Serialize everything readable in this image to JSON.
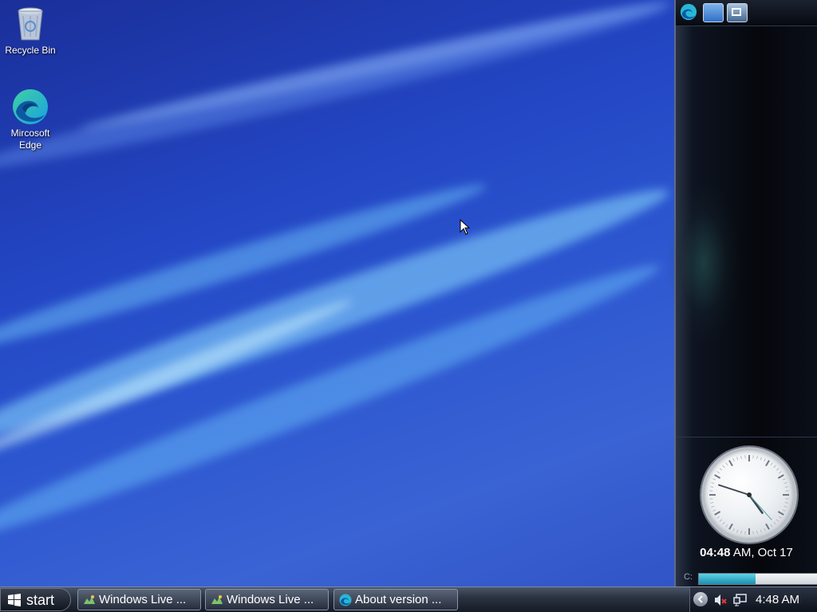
{
  "desktop": {
    "icons": [
      {
        "label": "Recycle Bin",
        "icon": "recycle-bin-icon"
      },
      {
        "label": "Mircosoft Edge",
        "icon": "edge-icon"
      }
    ]
  },
  "sidebar": {
    "toolbar_icons": [
      "edge-icon",
      "desktop-icon",
      "window-switch-icon"
    ],
    "clock": {
      "time_bold": "04:48",
      "time_rest": " AM, Oct 17",
      "hour": 4,
      "minute": 48,
      "second": 23
    },
    "drive": {
      "label": "C:",
      "used_fraction": 0.48
    }
  },
  "taskbar": {
    "start_label": "start",
    "tasks": [
      {
        "label": "Windows Live ...",
        "icon": "windows-live-icon"
      },
      {
        "label": "Windows Live ...",
        "icon": "windows-live-icon"
      },
      {
        "label": "About version ...",
        "icon": "edge-icon"
      }
    ],
    "tray": {
      "time": "4:48 AM",
      "icons": [
        "show-hidden-icon",
        "volume-muted-icon",
        "network-icon"
      ]
    }
  },
  "colors": {
    "wallpaper": "#2346c4",
    "taskbar": "#2b3342",
    "sidebar": "#05070c",
    "drive_fill": "#1a8fae"
  }
}
